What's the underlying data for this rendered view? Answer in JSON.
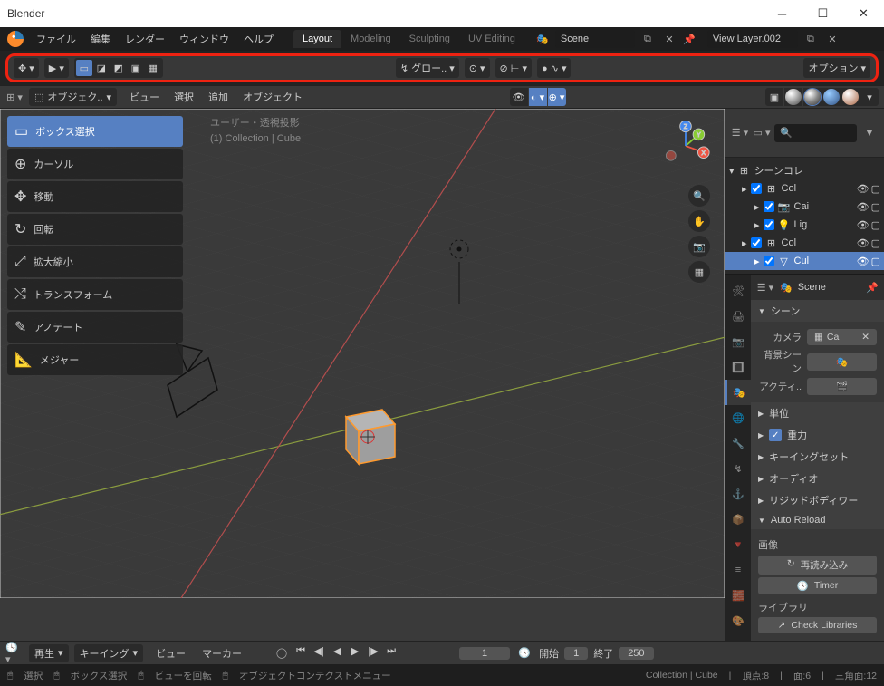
{
  "window_title": "Blender",
  "top_menu": [
    "ファイル",
    "編集",
    "レンダー",
    "ウィンドウ",
    "ヘルプ"
  ],
  "workspace_tabs": [
    "Layout",
    "Modeling",
    "Sculpting",
    "UV Editing"
  ],
  "workspace_active": 0,
  "scene_name": "Scene",
  "view_layer": "View Layer.002",
  "header_tool": {
    "transform_orient": "グロー..",
    "options_label": "オプション"
  },
  "bar2": {
    "mode": "オブジェク..",
    "menus": [
      "ビュー",
      "選択",
      "追加",
      "オブジェクト"
    ]
  },
  "tools": [
    "ボックス選択",
    "カーソル",
    "移動",
    "回転",
    "拡大縮小",
    "トランスフォーム",
    "アノテート",
    "メジャー"
  ],
  "tool_active": 0,
  "viewport_info": {
    "l1": "ユーザー・透視投影",
    "l2": "(1) Collection | Cube"
  },
  "gizmo_axes": [
    "X",
    "Y",
    "Z"
  ],
  "timeline": {
    "playback": "再生",
    "keying": "キーイング",
    "menus": [
      "ビュー",
      "マーカー"
    ],
    "current": "1",
    "start_label": "開始",
    "start": "1",
    "end_label": "終了",
    "end": "250"
  },
  "status": {
    "left": [
      "選択",
      "ボックス選択",
      "ビューを回転",
      "オブジェクトコンテクストメニュー"
    ],
    "right": [
      "Collection | Cube",
      "頂点:8",
      "面:6",
      "三角面:12"
    ]
  },
  "outliner": {
    "root": "シーンコレ",
    "items": [
      {
        "label": "Col",
        "indent": 1,
        "icon": "col"
      },
      {
        "label": "Cai",
        "indent": 2,
        "icon": "cam"
      },
      {
        "label": "Lig",
        "indent": 2,
        "icon": "light"
      },
      {
        "label": "Col",
        "indent": 1,
        "icon": "col"
      },
      {
        "label": "Cul",
        "indent": 2,
        "icon": "mesh",
        "sel": true
      }
    ]
  },
  "props": {
    "breadcrumb": "Scene",
    "panels": [
      {
        "label": "シーン",
        "exp": true
      },
      {
        "label": "単位",
        "exp": false
      },
      {
        "label": "重力",
        "exp": false,
        "check": true
      },
      {
        "label": "キーイングセット",
        "exp": false
      },
      {
        "label": "オーディオ",
        "exp": false
      },
      {
        "label": "リジッドボディワー",
        "exp": false
      },
      {
        "label": "Auto Reload",
        "exp": true
      }
    ],
    "scene_fields": {
      "camera_lbl": "カメラ",
      "camera_val": "Ca",
      "bg_lbl": "背景シーン",
      "active_lbl": "アクティ.."
    },
    "auto_reload": {
      "hdr": "画像",
      "reload": "再読み込み",
      "timer": "Timer",
      "lib_hdr": "ライブラリ",
      "check": "Check Libraries"
    }
  }
}
